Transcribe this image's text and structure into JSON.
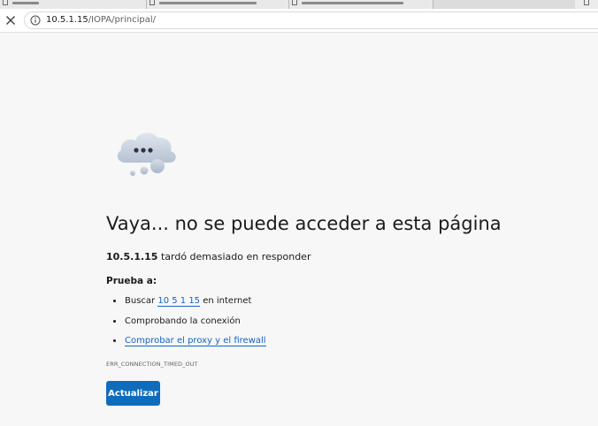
{
  "browser": {
    "url_host": "10.5.1.15",
    "url_path": "/IOPA/principal/"
  },
  "error_page": {
    "heading": "Vaya... no se puede acceder a esta página",
    "subtitle_host": "10.5.1.15",
    "subtitle_rest": " tardó demasiado en responder",
    "try_label": "Prueba a:",
    "suggestions": [
      {
        "prefix": "Buscar ",
        "link": "10 5 1 15",
        "suffix": " en internet"
      },
      {
        "text": "Comprobando la conexión"
      },
      {
        "link": "Comprobar el proxy y el firewall"
      }
    ],
    "error_code": "ERR_CONNECTION_TIMED_OUT",
    "refresh_label": "Actualizar"
  },
  "colors": {
    "accent": "#0f6cbd",
    "link": "#1463c7",
    "background": "#f7f7f7"
  },
  "icons": {
    "close": "close-icon",
    "info": "info-icon",
    "illustration": "cloud-illustration"
  }
}
